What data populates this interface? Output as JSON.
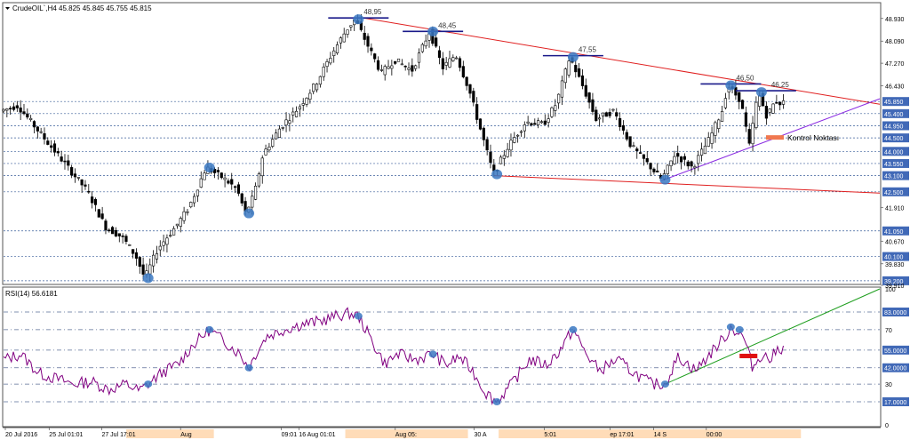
{
  "header": {
    "symbol": "CrudeOIL`,H4",
    "ohlc": "45.825 45.845 45.755 45.815"
  },
  "colors": {
    "background": "#ffffff",
    "candle_body": "#000000",
    "grid": "#3b5f9a",
    "price_label_bg": "#4169b7",
    "resistance_line": "#e02020",
    "support_line": "#8a2be2",
    "rsi_line": "#800080",
    "rsi_trend": "#1e9e1e",
    "pivot_marker": "#3a78c2",
    "pivot_bar": "#1a1a8a",
    "control_box": "#f07850",
    "rsi_control_box": "#e01010",
    "time_label_bg": "#ffd0a0"
  },
  "chart_data": [
    {
      "type": "candlestick",
      "title": "",
      "ylim": [
        39.13,
        49.45
      ],
      "price_axis_ticks": [
        "48.930",
        "48.090",
        "47.270",
        "46.430",
        "45.850",
        "45.400",
        "44.950",
        "44.500",
        "44.000",
        "43.550",
        "43.100",
        "42.500",
        "41.910",
        "41.050",
        "40.670",
        "40.100",
        "39.830",
        "39.200",
        "39.910"
      ],
      "dashed_levels": [
        45.85,
        45.4,
        44.95,
        44.5,
        44.0,
        43.55,
        43.1,
        42.5,
        41.05,
        40.1,
        39.2
      ],
      "dashed_level_labels": [
        "45.850",
        "45.400",
        "44.950",
        "44.500",
        "44.000",
        "43.550",
        "43.100",
        "42.500",
        "41.050",
        "40.100",
        "39.200"
      ],
      "trend_lines": {
        "resistance": {
          "from": [
            0.41,
            48.95
          ],
          "to": [
            1.0,
            45.75
          ]
        },
        "support_low": {
          "from": [
            0.56,
            43.1
          ],
          "to": [
            1.0,
            42.45
          ]
        },
        "support_rising": {
          "from": [
            0.75,
            42.9
          ],
          "to": [
            1.0,
            45.95
          ]
        }
      },
      "peak_annotations": [
        {
          "label": "48,95",
          "t": 0.405,
          "value": 48.95
        },
        {
          "label": "48,45",
          "t": 0.49,
          "value": 48.45
        },
        {
          "label": "47,55",
          "t": 0.65,
          "value": 47.55
        },
        {
          "label": "46,50",
          "t": 0.83,
          "value": 46.5
        },
        {
          "label": "46,25",
          "t": 0.87,
          "value": 46.25
        }
      ],
      "pivot_markers": [
        {
          "t": 0.165,
          "value": 39.3
        },
        {
          "t": 0.235,
          "value": 43.4
        },
        {
          "t": 0.28,
          "value": 41.7
        },
        {
          "t": 0.405,
          "value": 48.9
        },
        {
          "t": 0.49,
          "value": 48.45
        },
        {
          "t": 0.563,
          "value": 43.15
        },
        {
          "t": 0.65,
          "value": 47.5
        },
        {
          "t": 0.755,
          "value": 42.95
        },
        {
          "t": 0.83,
          "value": 46.45
        },
        {
          "t": 0.865,
          "value": 46.2
        }
      ],
      "control_point": {
        "label": "Kontrol Noktası",
        "t": 0.86,
        "value": 44.5
      },
      "price_path": [
        [
          0.0,
          45.5
        ],
        [
          0.02,
          45.7
        ],
        [
          0.04,
          44.9
        ],
        [
          0.06,
          44.1
        ],
        [
          0.08,
          43.3
        ],
        [
          0.1,
          42.5
        ],
        [
          0.12,
          41.2
        ],
        [
          0.14,
          40.8
        ],
        [
          0.155,
          40.1
        ],
        [
          0.165,
          39.3
        ],
        [
          0.18,
          40.4
        ],
        [
          0.2,
          41.2
        ],
        [
          0.215,
          41.9
        ],
        [
          0.235,
          43.4
        ],
        [
          0.255,
          43.0
        ],
        [
          0.27,
          42.6
        ],
        [
          0.28,
          41.7
        ],
        [
          0.29,
          42.4
        ],
        [
          0.3,
          43.9
        ],
        [
          0.32,
          44.9
        ],
        [
          0.34,
          45.6
        ],
        [
          0.36,
          46.5
        ],
        [
          0.38,
          47.7
        ],
        [
          0.395,
          48.5
        ],
        [
          0.405,
          48.9
        ],
        [
          0.42,
          47.9
        ],
        [
          0.435,
          46.9
        ],
        [
          0.45,
          47.4
        ],
        [
          0.47,
          47.0
        ],
        [
          0.49,
          48.45
        ],
        [
          0.505,
          47.1
        ],
        [
          0.52,
          47.6
        ],
        [
          0.535,
          46.3
        ],
        [
          0.55,
          44.6
        ],
        [
          0.563,
          43.15
        ],
        [
          0.58,
          44.2
        ],
        [
          0.6,
          45.1
        ],
        [
          0.62,
          45.0
        ],
        [
          0.635,
          45.8
        ],
        [
          0.65,
          47.5
        ],
        [
          0.665,
          46.4
        ],
        [
          0.68,
          45.2
        ],
        [
          0.7,
          45.5
        ],
        [
          0.72,
          44.2
        ],
        [
          0.74,
          43.5
        ],
        [
          0.755,
          42.95
        ],
        [
          0.77,
          43.9
        ],
        [
          0.79,
          43.4
        ],
        [
          0.81,
          44.5
        ],
        [
          0.825,
          45.6
        ],
        [
          0.83,
          46.45
        ],
        [
          0.845,
          45.9
        ],
        [
          0.855,
          44.2
        ],
        [
          0.865,
          46.2
        ],
        [
          0.875,
          45.3
        ],
        [
          0.885,
          45.9
        ],
        [
          0.89,
          45.8
        ]
      ]
    },
    {
      "type": "line",
      "title": "RSI(14) 56.6181",
      "ylim": [
        0,
        100
      ],
      "levels": [
        83,
        70,
        55,
        42,
        30,
        17
      ],
      "level_labels": [
        "83.0000",
        "70",
        "55.0000",
        "42.0000",
        "30",
        "17.0000"
      ],
      "axis_ticks": [
        "100",
        "83.0000",
        "70",
        "55.0000",
        "42.0000",
        "30",
        "17.0000",
        "0"
      ],
      "trend_line": {
        "from": [
          0.755,
          30
        ],
        "to": [
          1.0,
          100
        ]
      },
      "pivot_markers": [
        {
          "t": 0.165,
          "value": 30
        },
        {
          "t": 0.235,
          "value": 70
        },
        {
          "t": 0.28,
          "value": 42
        },
        {
          "t": 0.405,
          "value": 80
        },
        {
          "t": 0.49,
          "value": 52
        },
        {
          "t": 0.563,
          "value": 17
        },
        {
          "t": 0.65,
          "value": 70
        },
        {
          "t": 0.755,
          "value": 30
        },
        {
          "t": 0.83,
          "value": 72
        },
        {
          "t": 0.84,
          "value": 70
        }
      ],
      "control_point": {
        "t": 0.84,
        "value": 51
      },
      "series": [
        {
          "name": "RSI(14)",
          "values": [
            [
              0.0,
              48
            ],
            [
              0.02,
              52
            ],
            [
              0.04,
              38
            ],
            [
              0.06,
              34
            ],
            [
              0.08,
              30
            ],
            [
              0.1,
              32
            ],
            [
              0.12,
              26
            ],
            [
              0.14,
              30
            ],
            [
              0.155,
              25
            ],
            [
              0.165,
              30
            ],
            [
              0.18,
              38
            ],
            [
              0.2,
              45
            ],
            [
              0.215,
              58
            ],
            [
              0.235,
              70
            ],
            [
              0.255,
              60
            ],
            [
              0.27,
              52
            ],
            [
              0.28,
              42
            ],
            [
              0.29,
              55
            ],
            [
              0.3,
              65
            ],
            [
              0.32,
              70
            ],
            [
              0.34,
              74
            ],
            [
              0.36,
              76
            ],
            [
              0.38,
              80
            ],
            [
              0.395,
              82
            ],
            [
              0.405,
              80
            ],
            [
              0.42,
              62
            ],
            [
              0.435,
              45
            ],
            [
              0.45,
              52
            ],
            [
              0.47,
              48
            ],
            [
              0.49,
              52
            ],
            [
              0.505,
              44
            ],
            [
              0.52,
              50
            ],
            [
              0.535,
              40
            ],
            [
              0.55,
              24
            ],
            [
              0.563,
              17
            ],
            [
              0.58,
              30
            ],
            [
              0.6,
              48
            ],
            [
              0.62,
              44
            ],
            [
              0.635,
              55
            ],
            [
              0.65,
              70
            ],
            [
              0.665,
              52
            ],
            [
              0.68,
              40
            ],
            [
              0.7,
              48
            ],
            [
              0.72,
              38
            ],
            [
              0.74,
              30
            ],
            [
              0.755,
              30
            ],
            [
              0.77,
              50
            ],
            [
              0.79,
              40
            ],
            [
              0.81,
              55
            ],
            [
              0.825,
              66
            ],
            [
              0.83,
              72
            ],
            [
              0.845,
              64
            ],
            [
              0.855,
              42
            ],
            [
              0.865,
              52
            ],
            [
              0.875,
              48
            ],
            [
              0.885,
              57
            ],
            [
              0.89,
              56
            ]
          ]
        }
      ]
    }
  ],
  "time_axis": {
    "labels": [
      "20 Jul 2016",
      "25 Jul 01:01",
      "27 Jul 17:01",
      "Aug",
      "09:01",
      "16 Aug 01:01",
      "Aug 05:",
      "30 A",
      "5:01",
      "ep 17:01",
      "14 S",
      "00:00"
    ]
  }
}
